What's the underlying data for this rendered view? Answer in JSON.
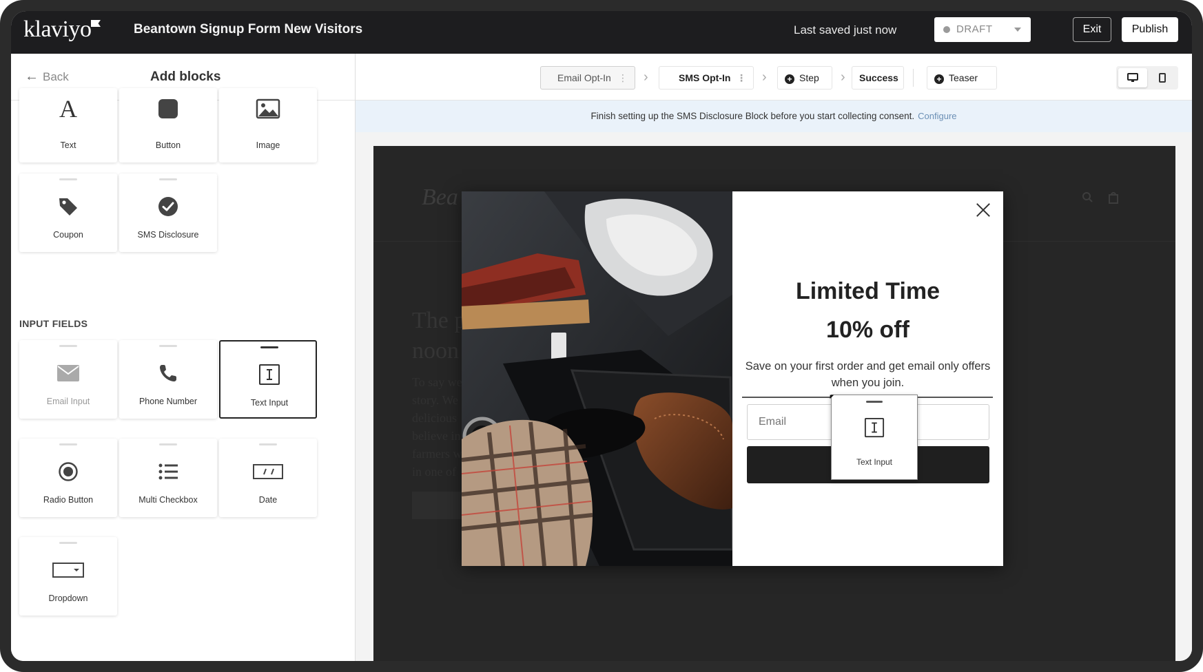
{
  "app": {
    "logo": "klaviyo",
    "form_title": "Beantown Signup Form New Visitors",
    "save_status": "Last saved just now",
    "status_select": "DRAFT",
    "exit_label": "Exit",
    "publish_label": "Publish"
  },
  "sidebar": {
    "back_label": "Back",
    "title": "Add blocks",
    "content_blocks": [
      {
        "label": "Text",
        "icon": "text-icon"
      },
      {
        "label": "Button",
        "icon": "button-icon"
      },
      {
        "label": "Image",
        "icon": "image-icon"
      },
      {
        "label": "Coupon",
        "icon": "tag-icon"
      },
      {
        "label": "SMS Disclosure",
        "icon": "check-circle-icon"
      }
    ],
    "input_section_label": "INPUT FIELDS",
    "input_blocks": [
      {
        "label": "Email Input",
        "icon": "envelope-icon"
      },
      {
        "label": "Phone Number",
        "icon": "phone-icon"
      },
      {
        "label": "Text Input",
        "icon": "text-cursor-icon"
      },
      {
        "label": "Radio Button",
        "icon": "radio-icon"
      },
      {
        "label": "Multi Checkbox",
        "icon": "list-icon"
      },
      {
        "label": "Date",
        "icon": "date-icon"
      },
      {
        "label": "Dropdown",
        "icon": "dropdown-icon"
      }
    ]
  },
  "steps": {
    "items": [
      "Email Opt-In",
      "SMS Opt-In",
      "Step",
      "Success",
      "Teaser"
    ],
    "active": "Email Opt-In"
  },
  "banner": {
    "message": "Finish setting up the SMS Disclosure Block before you start collecting consent.",
    "link": "Configure"
  },
  "modal": {
    "title_line1": "Limited Time",
    "title_line2": "10% off",
    "subtitle": "Save on your first order and get email only offers when you join.",
    "email_placeholder": "Email",
    "button_label": "Continue",
    "drag_ghost_label": "Text Input"
  },
  "background_site": {
    "logo_fragment": "Bea",
    "headline_fragment_1": "The p",
    "headline_fragment_2": "noon",
    "body_fragments": [
      "To say we",
      "story. We",
      "delicious",
      "believe in",
      "farmers w",
      "in one of"
    ]
  },
  "colors": {
    "topbar": "#1d1d1f",
    "banner": "#eaf2fa",
    "link": "#6b8fb5",
    "modal_button": "#1f1f1f"
  }
}
